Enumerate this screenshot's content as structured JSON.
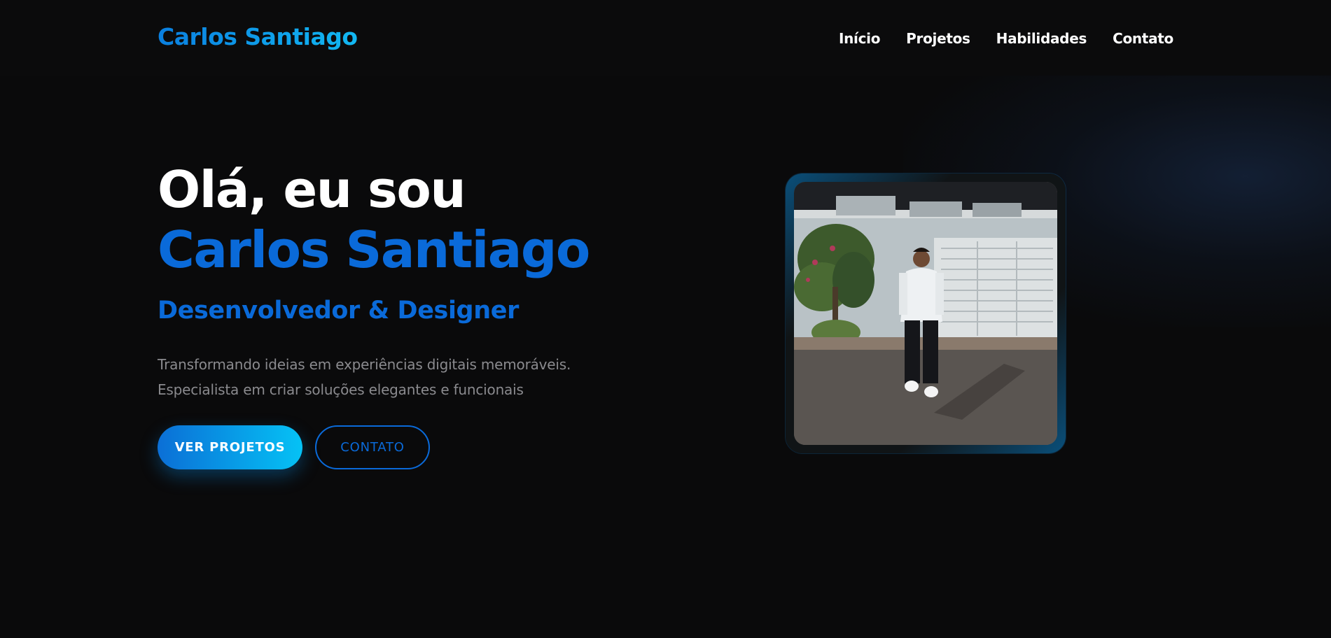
{
  "navbar": {
    "brand": "Carlos Santiago",
    "links": [
      "Início",
      "Projetos",
      "Habilidades",
      "Contato"
    ]
  },
  "hero": {
    "greeting": "Olá, eu sou",
    "name": "Carlos Santiago",
    "subtitle": "Desenvolvedor & Designer",
    "description_line1": "Transformando ideias em experiências digitais memoráveis.",
    "description_line2": "Especialista em criar soluções elegantes e funcionais",
    "primary_button": "VER PROJETOS",
    "secondary_button": "CONTATO"
  },
  "photo": {
    "subject": "profile-photo"
  },
  "colors": {
    "background": "#0a0a0b",
    "accent": "#0a6ad9",
    "accent_light": "#05c2f5",
    "muted_text": "#8a8a8e"
  }
}
